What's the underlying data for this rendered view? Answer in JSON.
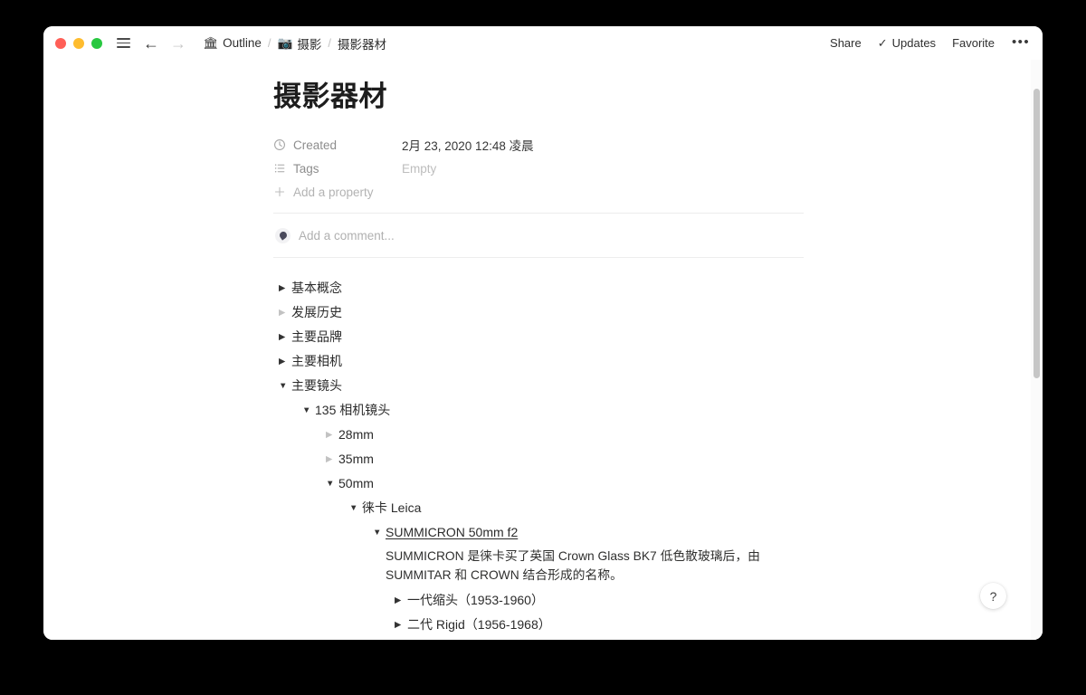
{
  "window": {
    "traffic_lights": [
      "close",
      "minimize",
      "maximize"
    ]
  },
  "titlebar": {
    "menu_icon": "hamburger-icon",
    "back_icon": "←",
    "forward_icon": "→",
    "breadcrumb": [
      {
        "emoji": "🏛",
        "label": "Outline"
      },
      {
        "emoji": "📷",
        "label": "摄影"
      },
      {
        "emoji": "",
        "label": "摄影器材"
      }
    ],
    "separator": "/",
    "share_label": "Share",
    "updates_label": "Updates",
    "updates_check": "✓",
    "favorite_label": "Favorite",
    "more_label": "•••"
  },
  "page": {
    "title": "摄影器材",
    "properties": [
      {
        "icon": "clock-icon",
        "label": "Created",
        "value": "2月 23, 2020 12:48 凌晨",
        "empty": false
      },
      {
        "icon": "tags-icon",
        "label": "Tags",
        "value": "Empty",
        "empty": true
      }
    ],
    "add_property_label": "Add a property",
    "add_property_icon": "plus-icon",
    "comment_placeholder": "Add a comment..."
  },
  "tree": [
    {
      "depth": 0,
      "tri": "▶",
      "dim": false,
      "label": "基本概念",
      "underline": false
    },
    {
      "depth": 0,
      "tri": "▶",
      "dim": true,
      "label": "发展历史",
      "underline": false
    },
    {
      "depth": 0,
      "tri": "▶",
      "dim": false,
      "label": "主要品牌",
      "underline": false
    },
    {
      "depth": 0,
      "tri": "▶",
      "dim": false,
      "label": "主要相机",
      "underline": false
    },
    {
      "depth": 0,
      "tri": "▼",
      "dim": false,
      "label": "主要镜头",
      "underline": false
    },
    {
      "depth": 1,
      "tri": "▼",
      "dim": false,
      "label": "135 相机镜头",
      "underline": false
    },
    {
      "depth": 2,
      "tri": "▶",
      "dim": true,
      "label": "28mm",
      "underline": false
    },
    {
      "depth": 2,
      "tri": "▶",
      "dim": true,
      "label": "35mm",
      "underline": false
    },
    {
      "depth": 2,
      "tri": "▼",
      "dim": false,
      "label": "50mm",
      "underline": false
    },
    {
      "depth": 3,
      "tri": "▼",
      "dim": false,
      "label": "徕卡 Leica",
      "underline": false
    },
    {
      "depth": 4,
      "tri": "▼",
      "dim": false,
      "label": "SUMMICRON 50mm f2",
      "underline": true
    },
    {
      "depth": 4,
      "tri": "",
      "dim": false,
      "label": "SUMMICRON 是徕卡买了英国 Crown Glass BK7 低色散玻璃后，由 SUMMITAR 和 CROWN 结合形成的名称。",
      "underline": false,
      "paragraph": true
    },
    {
      "depth": 5,
      "tri": "▶",
      "dim": false,
      "label": "一代缩头（1953-1960）",
      "underline": false
    },
    {
      "depth": 5,
      "tri": "▶",
      "dim": false,
      "label": "二代 Rigid（1956-1968）",
      "underline": false
    }
  ],
  "help": {
    "label": "?"
  },
  "colors": {
    "accent_red": "#ff5f57",
    "accent_yellow": "#febc2e",
    "accent_green": "#28c840",
    "text": "#2b2b2b",
    "muted": "#8d8d8d",
    "background": "#ffffff"
  }
}
